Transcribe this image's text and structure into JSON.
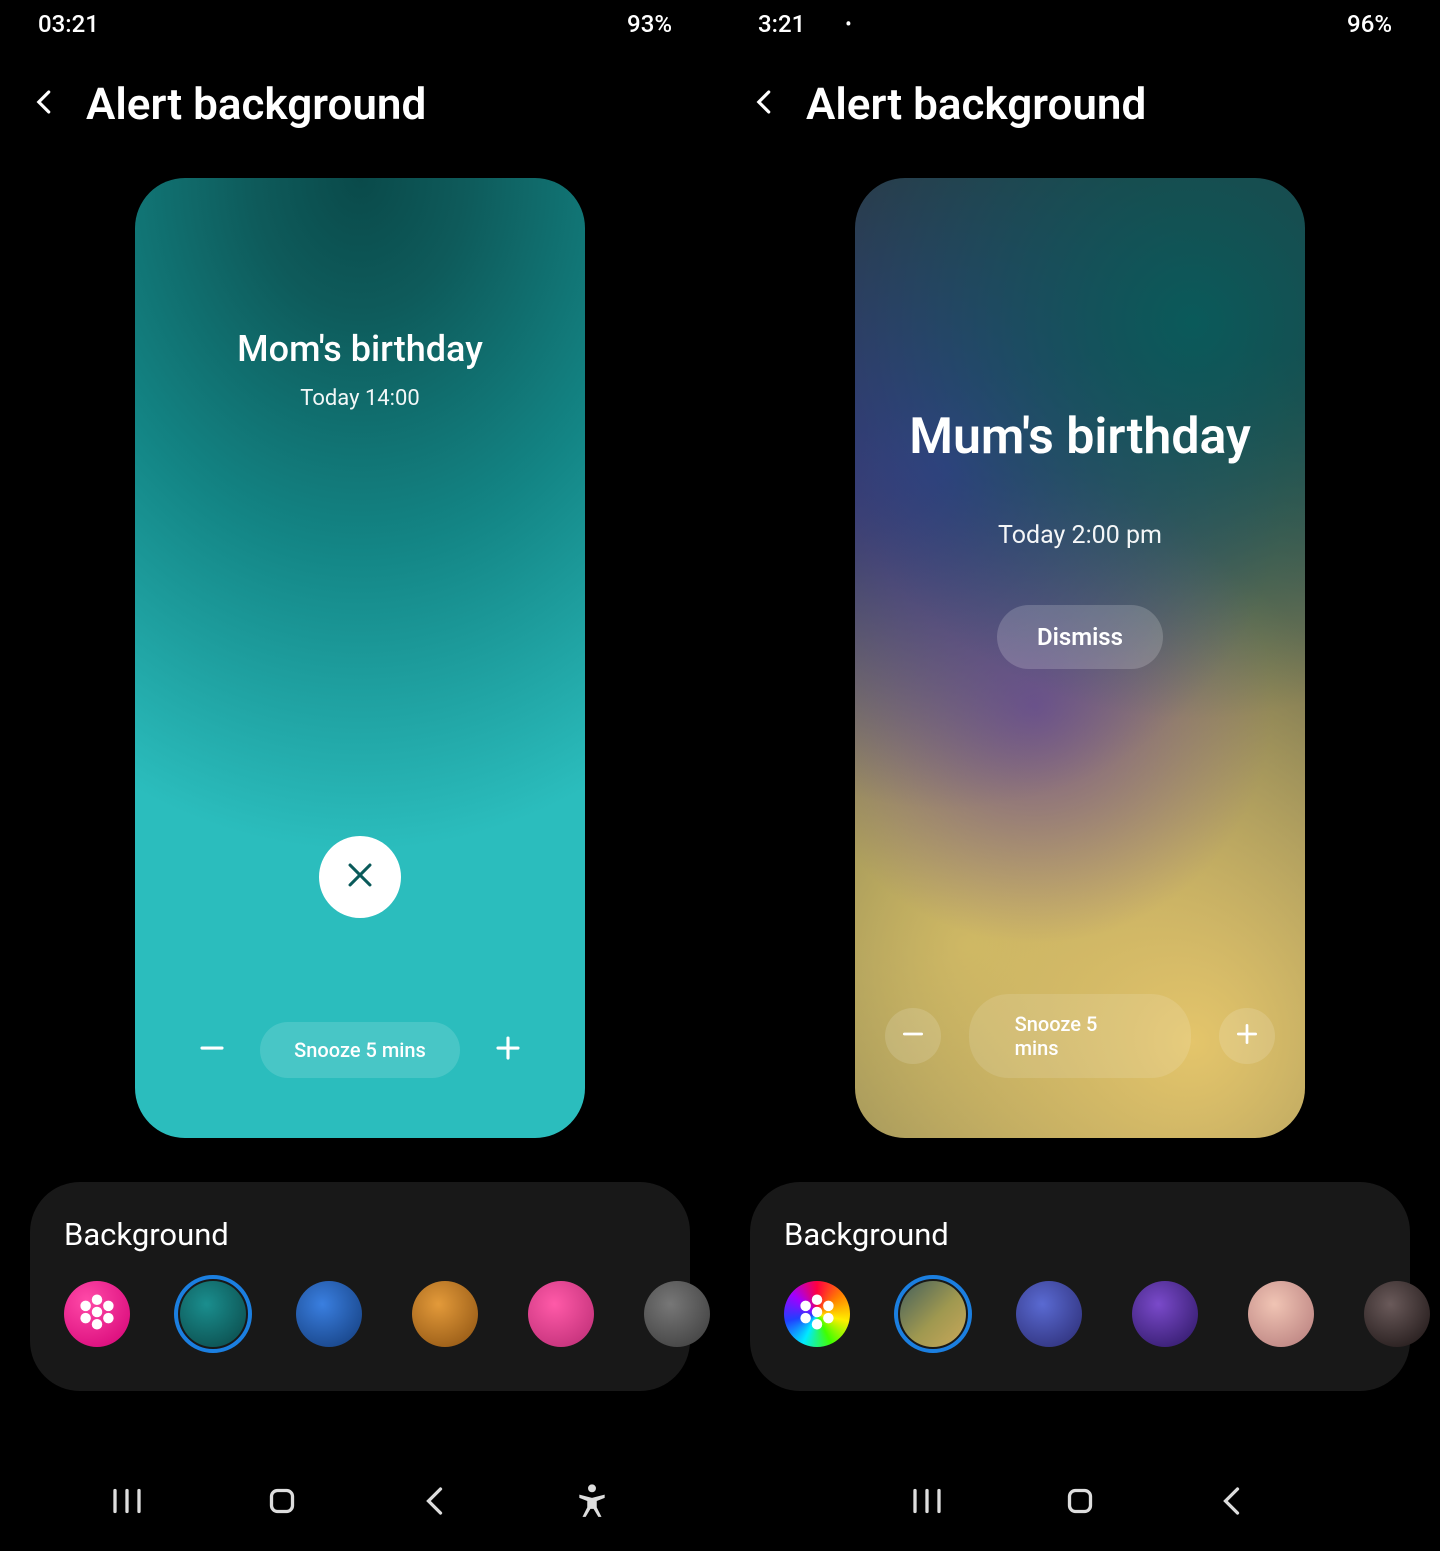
{
  "left": {
    "status": {
      "time": "03:21",
      "battery": "93%"
    },
    "header": {
      "title": "Alert background"
    },
    "preview": {
      "title": "Mom's birthday",
      "subtitle": "Today 14:00",
      "snooze_label": "Snooze 5 mins"
    },
    "background_card": {
      "title": "Background",
      "swatches": [
        "gallery-pink",
        "teal",
        "blue",
        "orange",
        "fuchsia",
        "grey"
      ],
      "selected_index": 1
    }
  },
  "right": {
    "status": {
      "time": "3:21",
      "battery": "96%"
    },
    "header": {
      "title": "Alert background"
    },
    "preview": {
      "title": "Mum's birthday",
      "subtitle": "Today 2:00 pm",
      "dismiss_label": "Dismiss",
      "snooze_label": "Snooze 5 mins"
    },
    "background_card": {
      "title": "Background",
      "swatches": [
        "gallery-rainbow",
        "olive",
        "indigo",
        "purple",
        "peach",
        "dark"
      ],
      "selected_index": 1
    }
  }
}
